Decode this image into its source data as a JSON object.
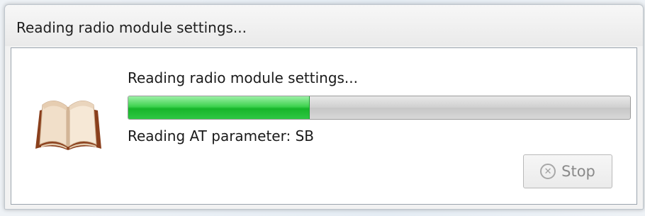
{
  "window": {
    "title": "Reading radio module settings..."
  },
  "dialog": {
    "icon": "open-book-icon",
    "status_text": "Reading radio module settings...",
    "detail_text": "Reading AT parameter: SB",
    "progress": 0.36
  },
  "buttons": {
    "stop_label": "Stop",
    "stop_icon": "cancel-circle-icon",
    "stop_enabled": false
  },
  "colors": {
    "progress_fill": "#2fc744",
    "progress_track": "#cfcfcf",
    "disabled_text": "#8a8a8a"
  }
}
